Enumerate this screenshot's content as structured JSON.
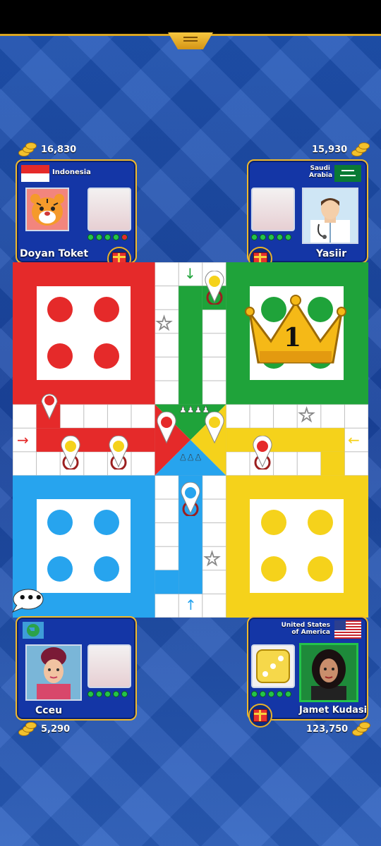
{
  "top_left_player": {
    "coins": "16,830",
    "country": "Indonesia",
    "name": "Doyan Toket"
  },
  "top_right_player": {
    "coins": "15,930",
    "country_line1": "Saudi",
    "country_line2": "Arabia",
    "name": "Yasiir"
  },
  "bottom_left_player": {
    "coins": "5,290",
    "name": "Cceu"
  },
  "bottom_right_player": {
    "coins": "123,750",
    "country_line1": "United States",
    "country_line2": "of America",
    "name": "Jamet Kudasi"
  },
  "green_rank": "1",
  "chat_bubble": "•••",
  "colors": {
    "red": "#e52a2a",
    "green": "#1fa33a",
    "yellow": "#f5d21b",
    "blue": "#27a4ee"
  },
  "icons": [
    "coins-icon",
    "gift-icon",
    "crown-icon",
    "star-icon",
    "arrow-icon",
    "chat-icon",
    "globe-icon"
  ]
}
